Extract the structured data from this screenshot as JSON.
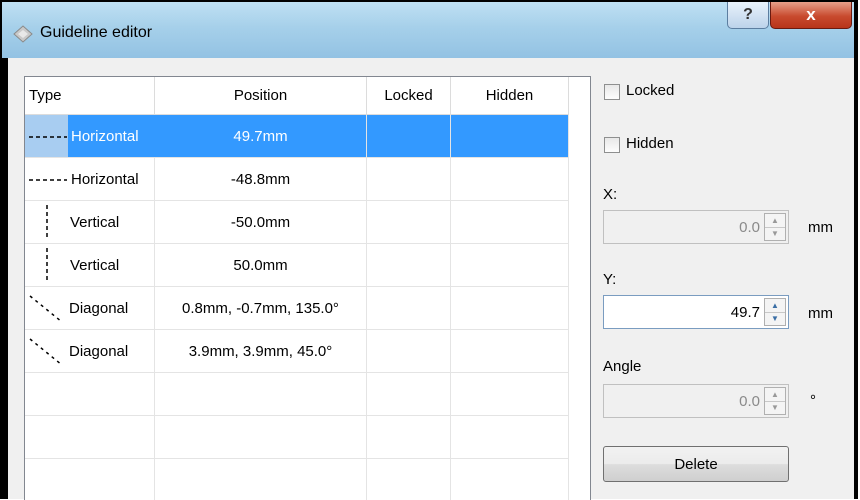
{
  "window": {
    "title": "Guideline editor",
    "help_label": "?",
    "close_label": "x"
  },
  "table": {
    "columns": [
      "Type",
      "Position",
      "Locked",
      "Hidden"
    ],
    "rows": [
      {
        "type": "Horizontal",
        "position": "49.7mm",
        "locked": "",
        "hidden": "",
        "icon": "horizontal-line-icon",
        "selected": true
      },
      {
        "type": "Horizontal",
        "position": "-48.8mm",
        "locked": "",
        "hidden": "",
        "icon": "horizontal-line-icon",
        "selected": false
      },
      {
        "type": "Vertical",
        "position": "-50.0mm",
        "locked": "",
        "hidden": "",
        "icon": "vertical-line-icon",
        "selected": false
      },
      {
        "type": "Vertical",
        "position": "50.0mm",
        "locked": "",
        "hidden": "",
        "icon": "vertical-line-icon",
        "selected": false
      },
      {
        "type": "Diagonal",
        "position": "0.8mm, -0.7mm, 135.0°",
        "locked": "",
        "hidden": "",
        "icon": "diagonal-line-icon",
        "selected": false
      },
      {
        "type": "Diagonal",
        "position": "3.9mm, 3.9mm, 45.0°",
        "locked": "",
        "hidden": "",
        "icon": "diagonal-line-icon",
        "selected": false
      }
    ]
  },
  "props": {
    "locked_label": "Locked",
    "locked_checked": false,
    "hidden_label": "Hidden",
    "hidden_checked": false,
    "x_label": "X:",
    "x_value": "0.0",
    "x_unit": "mm",
    "y_label": "Y:",
    "y_value": "49.7",
    "y_unit": "mm",
    "angle_label": "Angle",
    "angle_value": "0.0",
    "angle_unit": "°",
    "delete_label": "Delete"
  },
  "colors": {
    "selection": "#3399ff",
    "titlebar": "#a6d0ea",
    "close": "#c84a2e"
  }
}
